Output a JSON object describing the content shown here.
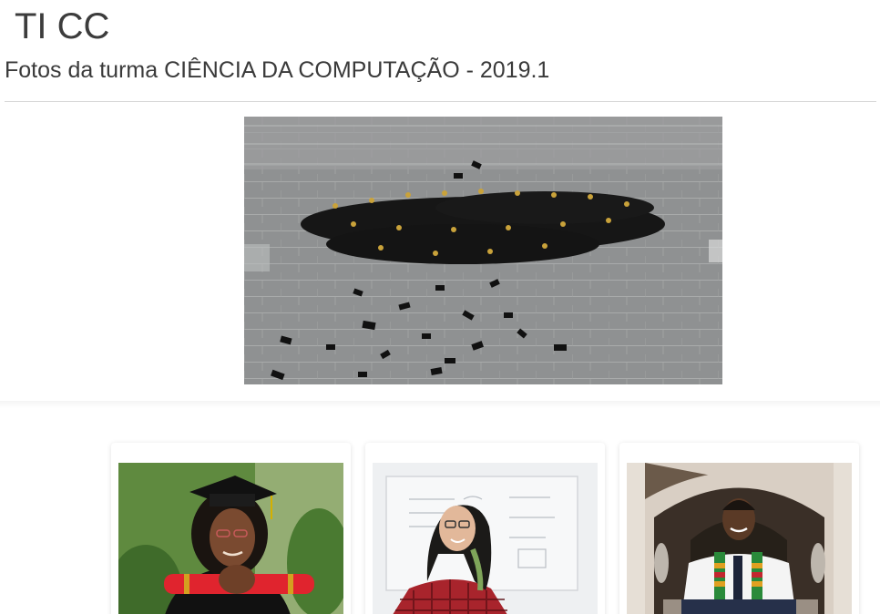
{
  "header": {
    "app_title": "TI CC",
    "subtitle": "Fotos da turma CIÊNCIA DA COMPUTAÇÃO - 2019.1"
  },
  "hero": {
    "image": "graduation-class-aerial-photo"
  },
  "gallery": {
    "cards": [
      {
        "image": "graduate-woman-with-diploma-photo"
      },
      {
        "image": "woman-at-whiteboard-photo"
      },
      {
        "image": "graduate-man-with-stole-photo"
      }
    ]
  },
  "colors": {
    "text": "#3c3c3c",
    "divider": "#d6d6d6",
    "diploma_red": "#e0242e",
    "plaid_red": "#b3262e"
  }
}
